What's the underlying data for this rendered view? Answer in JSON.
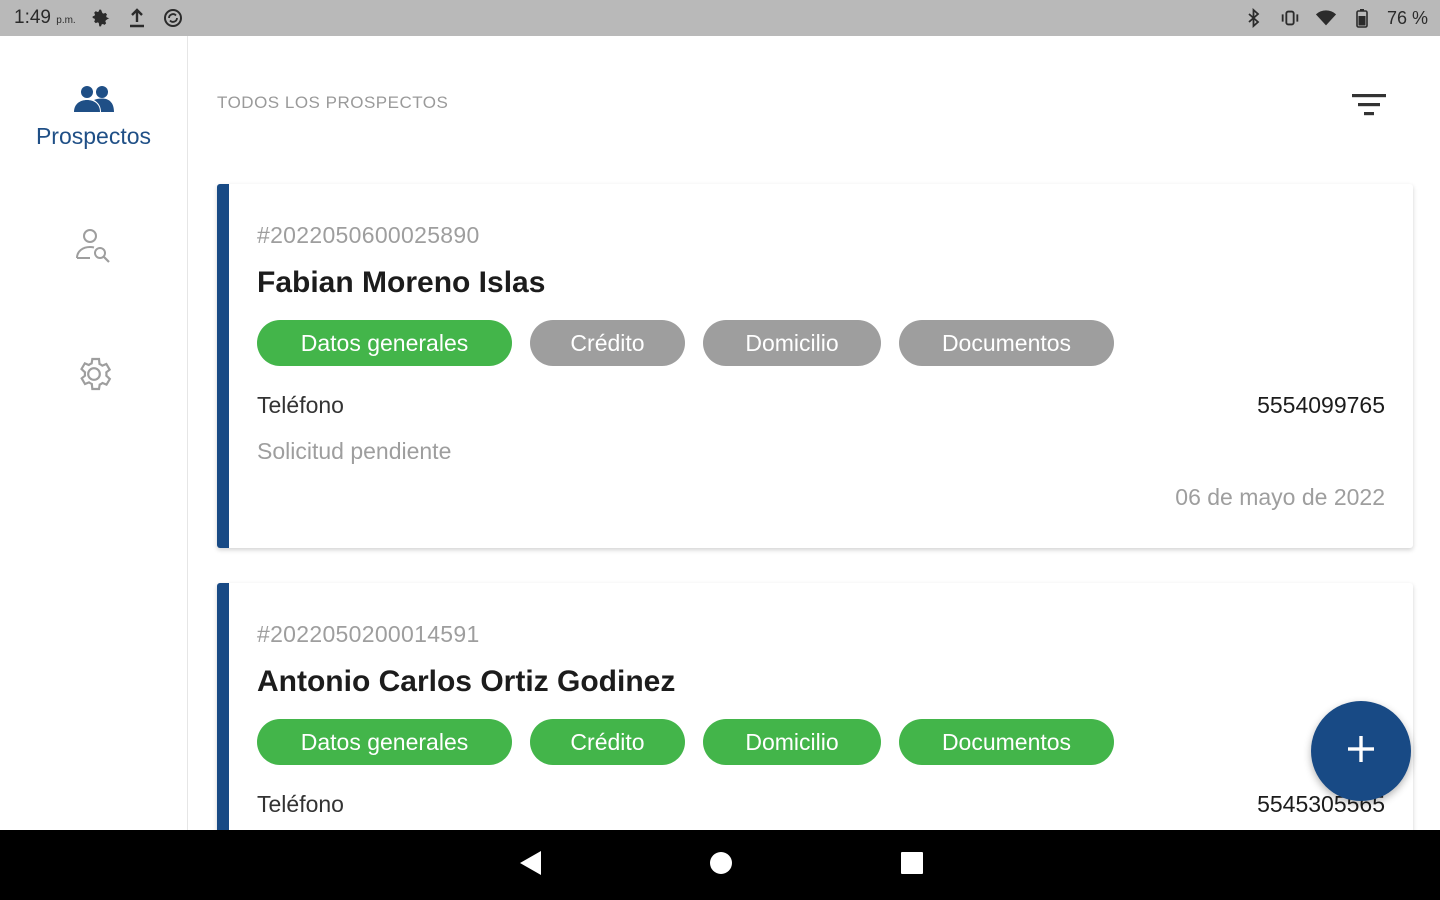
{
  "status_bar": {
    "time": "1:49",
    "time_suffix": "p.m.",
    "battery": "76 %"
  },
  "sidebar": {
    "items": [
      {
        "label": "Prospectos",
        "icon": "people-icon",
        "active": true
      },
      {
        "label": "",
        "icon": "person-search-icon",
        "active": false
      },
      {
        "label": "",
        "icon": "gear-icon",
        "active": false
      }
    ]
  },
  "header": {
    "title": "TODOS LOS PROSPECTOS",
    "filter_icon": "filter-icon"
  },
  "prospects": [
    {
      "number": "#2022050600025890",
      "name": "Fabian Moreno Islas",
      "chips": [
        {
          "label": "Datos generales",
          "state": "complete"
        },
        {
          "label": "Crédito",
          "state": "pending"
        },
        {
          "label": "Domicilio",
          "state": "pending"
        },
        {
          "label": "Documentos",
          "state": "pending"
        }
      ],
      "phone_label": "Teléfono",
      "phone": "5554099765",
      "status": "Solicitud pendiente",
      "date": "06 de mayo de 2022"
    },
    {
      "number": "#2022050200014591",
      "name": "Antonio Carlos Ortiz Godinez",
      "chips": [
        {
          "label": "Datos generales",
          "state": "complete"
        },
        {
          "label": "Crédito",
          "state": "complete"
        },
        {
          "label": "Domicilio",
          "state": "complete"
        },
        {
          "label": "Documentos",
          "state": "complete"
        }
      ],
      "phone_label": "Teléfono",
      "phone": "5545305565"
    }
  ],
  "fab": {
    "icon": "plus-icon"
  },
  "colors": {
    "primary": "#184a85",
    "complete": "#43b54a",
    "pending": "#9e9e9e",
    "status_bar": "#b9b9b9"
  }
}
